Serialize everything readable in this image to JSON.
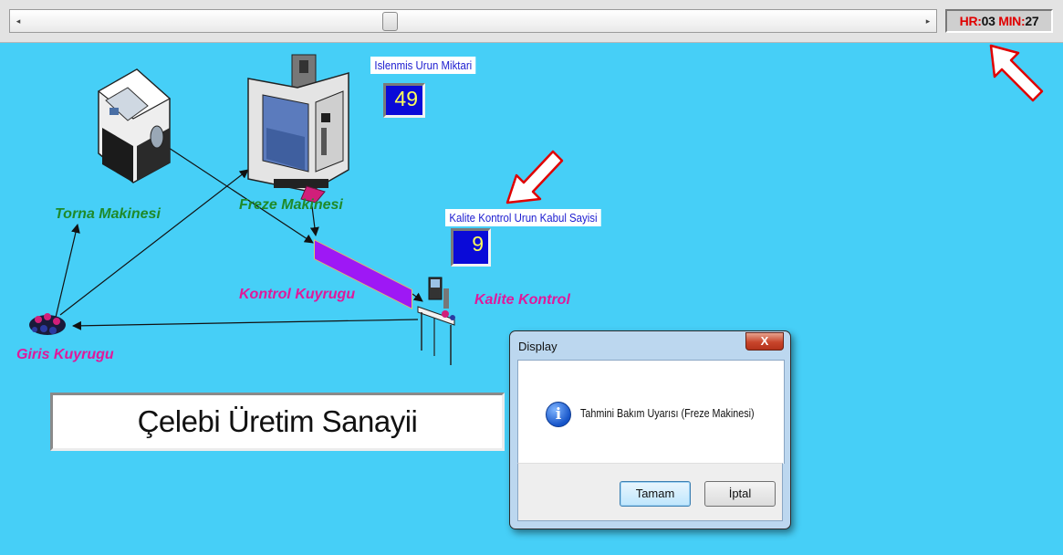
{
  "clock": {
    "hr_label": "HR:",
    "hr_value": "03",
    "min_label": "MIN:",
    "min_value": "27"
  },
  "stations": {
    "torna": "Torna Makinesi",
    "freze": "Freze Makinesi",
    "kontrol_kuyrugu": "Kontrol Kuyrugu",
    "kalite_kontrol": "Kalite Kontrol",
    "giris_kuyrugu": "Giris Kuyrugu"
  },
  "counters": {
    "processed_label": "Islenmis Urun Miktari",
    "processed_value": "49",
    "accepted_label": "Kalite Kontrol Urun Kabul Sayisi",
    "accepted_value": "9"
  },
  "company_title": "Çelebi Üretim Sanayii",
  "dialog": {
    "title": "Display",
    "close_label": "X",
    "message": "Tahmini Bakım Uyarısı (Freze Makinesi)",
    "ok_label": "Tamam",
    "cancel_label": "İptal"
  },
  "colors": {
    "background": "#46cff7",
    "station_green": "#1f8a2a",
    "station_magenta": "#e0199b",
    "counter_bg": "#0a0ad8",
    "counter_text": "#ffff5a",
    "conveyor": "#9e18f5",
    "annotation_arrow": "#e00000"
  },
  "icons": {
    "scroll_left": "arrow-left-icon",
    "scroll_right": "arrow-right-icon",
    "dialog_info": "info-icon",
    "dialog_close": "close-icon"
  }
}
